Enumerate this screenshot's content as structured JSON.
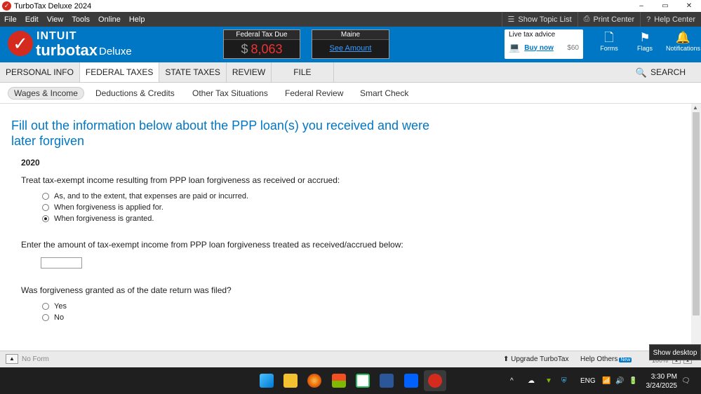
{
  "window": {
    "title": "TurboTax Deluxe 2024",
    "controls": [
      "–",
      "▭",
      "✕"
    ]
  },
  "menu": {
    "items": [
      "File",
      "Edit",
      "View",
      "Tools",
      "Online",
      "Help"
    ],
    "right": [
      {
        "icon": "list-icon",
        "label": "Show Topic List"
      },
      {
        "icon": "printer-icon",
        "label": "Print Center"
      },
      {
        "icon": "help-icon",
        "label": "Help Center"
      }
    ]
  },
  "header": {
    "brand_top": "INTUIT",
    "brand_main": "turbotax",
    "brand_edition": "Deluxe",
    "federal": {
      "label": "Federal Tax Due",
      "currency": "$",
      "amount": "8,063"
    },
    "state": {
      "label": "Maine",
      "link": "See Amount"
    },
    "advice": {
      "title": "Live tax advice",
      "buy": "Buy now",
      "price": "$60"
    },
    "icons": [
      {
        "name": "forms-icon",
        "label": "Forms"
      },
      {
        "name": "flags-icon",
        "label": "Flags"
      },
      {
        "name": "notifications-icon",
        "label": "Notifications"
      }
    ],
    "colors": {
      "brand_blue": "#0077c5",
      "check_red": "#d52b1e",
      "due_red": "#e33333"
    }
  },
  "tabs": {
    "items": [
      "PERSONAL INFO",
      "FEDERAL TAXES",
      "STATE TAXES",
      "REVIEW",
      "FILE"
    ],
    "active": "FEDERAL TAXES",
    "search": "SEARCH"
  },
  "subtabs": {
    "items": [
      "Wages & Income",
      "Deductions & Credits",
      "Other Tax Situations",
      "Federal Review",
      "Smart Check"
    ],
    "active": "Wages & Income"
  },
  "main": {
    "title": "Fill out the information below about the PPP loan(s) you received and were later forgiven",
    "year": "2020",
    "q1": "Treat tax-exempt income resulting from PPP loan forgiveness as received or accrued:",
    "q1_options": [
      "As, and to the extent, that expenses are paid or incurred.",
      "When forgiveness is applied for.",
      "When forgiveness is granted."
    ],
    "q1_selected": 2,
    "q2": "Enter the amount of tax-exempt income from PPP loan forgiveness treated as received/accrued below:",
    "q2_value": "",
    "q3": "Was forgiveness granted as of the date return was filed?",
    "q3_options": [
      "Yes",
      "No"
    ]
  },
  "bottombar": {
    "no_form": "No Form",
    "upgrade": "Upgrade TurboTax",
    "help_others": "Help Others",
    "new_badge": "New",
    "zoom": "100%"
  },
  "tooltip": "Show desktop",
  "taskbar": {
    "apps": [
      "start-icon",
      "file-explorer-icon",
      "firefox-icon",
      "store-icon",
      "evernote-icon",
      "word-icon",
      "dropbox-icon",
      "turbotax-icon"
    ],
    "lang": "ENG",
    "time": "3:30 PM",
    "date": "3/24/2025"
  }
}
